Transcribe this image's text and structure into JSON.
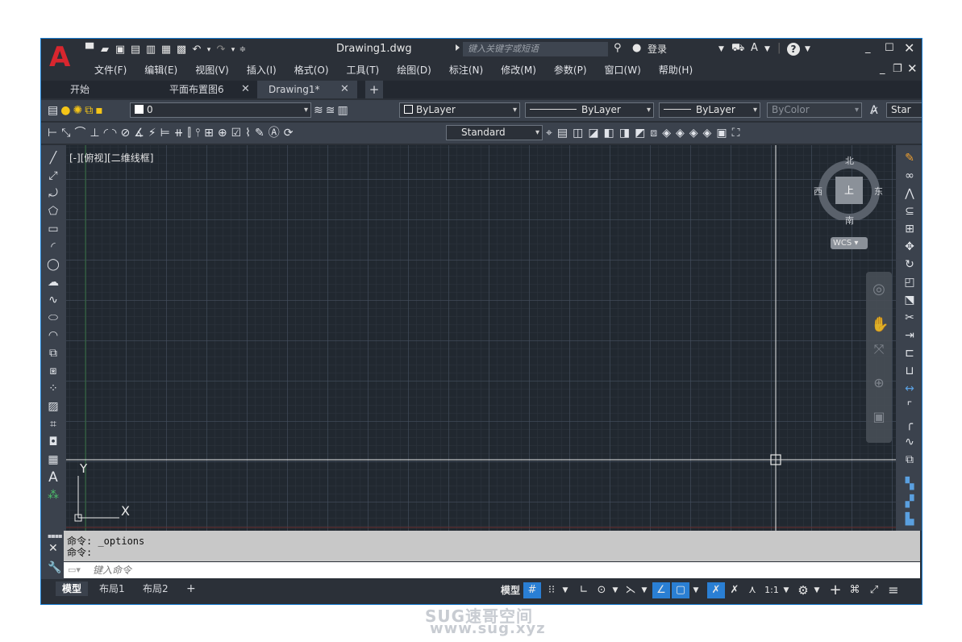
{
  "app": {
    "title": "Drawing1.dwg",
    "search_placeholder": "键入关键字或短语",
    "login": "登录",
    "help_icon": "?"
  },
  "menubar": [
    "文件(F)",
    "编辑(E)",
    "视图(V)",
    "插入(I)",
    "格式(O)",
    "工具(T)",
    "绘图(D)",
    "标注(N)",
    "修改(M)",
    "参数(P)",
    "窗口(W)",
    "帮助(H)"
  ],
  "file_tabs": [
    {
      "label": "开始",
      "active": false
    },
    {
      "label": "平面布置图6",
      "active": false
    },
    {
      "label": "Drawing1*",
      "active": true
    }
  ],
  "layer_toolbar": {
    "layer_name": "0",
    "color": "ByLayer",
    "linetype": "ByLayer",
    "lineweight": "ByLayer",
    "plotstyle": "ByColor",
    "text_style": "Star"
  },
  "dim_toolbar": {
    "dim_style": "Standard"
  },
  "viewport": {
    "label": "[-][俯视][二维线框]",
    "ucs_x": "X",
    "ucs_y": "Y"
  },
  "viewcube": {
    "north": "北",
    "south": "南",
    "east": "东",
    "west": "西",
    "face": "上",
    "wcs": "WCS"
  },
  "command": {
    "history": [
      "命令: _options",
      "命令:"
    ],
    "placeholder": "键入命令"
  },
  "layout_tabs": [
    {
      "label": "模型",
      "active": true
    },
    {
      "label": "布局1",
      "active": false
    },
    {
      "label": "布局2",
      "active": false
    }
  ],
  "status": {
    "model": "模型",
    "scale": "1:1"
  },
  "watermark": {
    "line1": "SUG速哥空间",
    "line2": "www.sug.xyz"
  },
  "colors": {
    "frame": "#2b3038",
    "toolbar": "#3b424d",
    "canvas": "#212830",
    "accent": "#2a7fd4",
    "logo": "#d8262e"
  }
}
